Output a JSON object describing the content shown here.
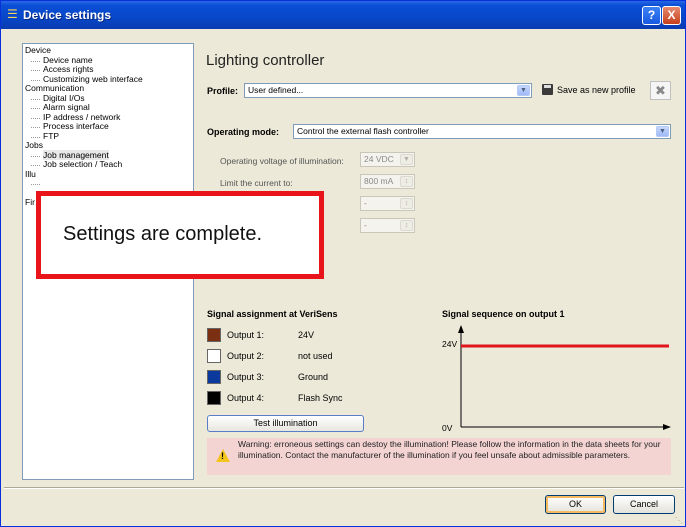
{
  "window": {
    "title": "Device settings",
    "help_label": "?",
    "close_label": "X"
  },
  "tree": [
    {
      "label": "Device",
      "level": 0
    },
    {
      "label": "Device name",
      "level": 1
    },
    {
      "label": "Access rights",
      "level": 1
    },
    {
      "label": "Customizing web interface",
      "level": 1
    },
    {
      "label": "Communication",
      "level": 0
    },
    {
      "label": "Digital I/Os",
      "level": 1
    },
    {
      "label": "Alarm signal",
      "level": 1
    },
    {
      "label": "IP address / network",
      "level": 1
    },
    {
      "label": "Process interface",
      "level": 1
    },
    {
      "label": "FTP",
      "level": 1
    },
    {
      "label": "Jobs",
      "level": 0
    },
    {
      "label": "Job management",
      "level": 1,
      "selected": true
    },
    {
      "label": "Job selection / Teach",
      "level": 1
    },
    {
      "label": "Illu",
      "level": 0
    },
    {
      "label": "",
      "level": 1
    },
    {
      "label": "",
      "level": 0
    },
    {
      "label": "Fir",
      "level": 0
    }
  ],
  "main": {
    "title": "Lighting controller",
    "profile_label": "Profile:",
    "profile_value": "User defined...",
    "save_profile_label": "Save as new profile",
    "operating_mode_label": "Operating mode:",
    "operating_mode_value": "Control the external flash controller",
    "voltage_label": "Operating voltage of illumination:",
    "voltage_value": "24 VDC",
    "current_label": "Limit the current to:",
    "current_value": "800 mA",
    "spinner3_value": "-",
    "spinner4_value": "-"
  },
  "callout": {
    "text": "Settings are complete."
  },
  "signal_assignment": {
    "title": "Signal assignment at VeriSens",
    "outputs": [
      {
        "label": "Output 1:",
        "value": "24V",
        "color": "#7b2f13"
      },
      {
        "label": "Output 2:",
        "value": "not used",
        "color": "#ffffff"
      },
      {
        "label": "Output 3:",
        "value": "Ground",
        "color": "#0b3a9c"
      },
      {
        "label": "Output 4:",
        "value": "Flash Sync",
        "color": "#000000"
      }
    ],
    "test_button": "Test illumination"
  },
  "signal_sequence": {
    "title": "Signal sequence on output 1",
    "high_label": "24V",
    "low_label": "0V",
    "line_color": "#e0141a"
  },
  "warning": {
    "text": "Warning:  erroneous settings can destoy the illumination! Please follow the information in the data sheets for your illumination. Contact the manufacturer of the illumination if you feel unsafe about admissible parameters."
  },
  "buttons": {
    "ok": "OK",
    "cancel": "Cancel"
  }
}
